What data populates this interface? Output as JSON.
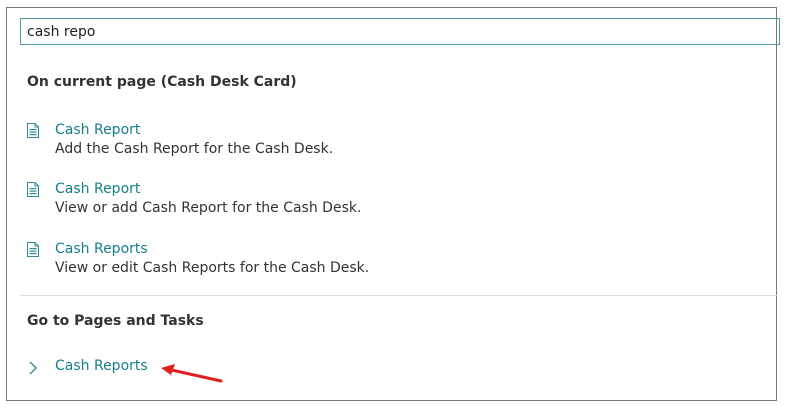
{
  "search": {
    "value": "cash repo"
  },
  "current_page": {
    "heading": "On current page (Cash Desk Card)",
    "items": [
      {
        "title": "Cash Report",
        "description": "Add the Cash Report for the Cash Desk.",
        "icon": "document-icon"
      },
      {
        "title": "Cash Report",
        "description": "View or add Cash Report for the Cash Desk.",
        "icon": "document-icon"
      },
      {
        "title": "Cash Reports",
        "description": "View or edit Cash Reports for the Cash Desk.",
        "icon": "document-icon"
      }
    ]
  },
  "pages_tasks": {
    "heading": "Go to Pages and Tasks",
    "items": [
      {
        "title": "Cash Reports",
        "icon": "chevron-right-icon"
      }
    ]
  },
  "annotation": {
    "type": "red-arrow",
    "color": "#e02020"
  },
  "colors": {
    "link": "#167e8a",
    "search_border": "#4b9aa8",
    "icon": "#2e8a96",
    "text": "#333333"
  }
}
